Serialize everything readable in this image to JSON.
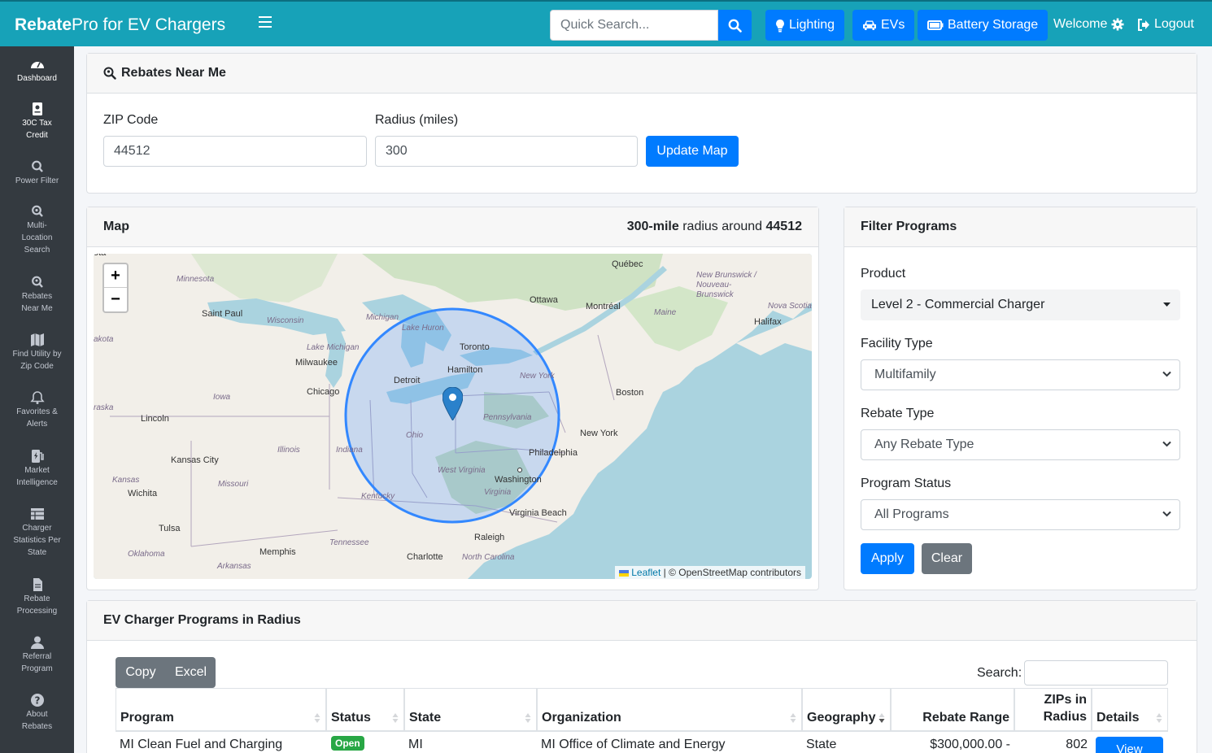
{
  "app": {
    "brand_bold": "Rebate",
    "brand_rest": "Pro for EV Chargers"
  },
  "topnav": {
    "search_placeholder": "Quick Search...",
    "buttons": [
      "Lighting",
      "EVs",
      "Battery Storage"
    ],
    "welcome": "Welcome",
    "logout": "Logout"
  },
  "sidebar": {
    "items": [
      {
        "label": "Dashboard",
        "icon": "gauge-icon"
      },
      {
        "label": "30C Tax Credit",
        "icon": "document-icon"
      },
      {
        "label": "Power Filter",
        "icon": "search-icon"
      },
      {
        "label": "Multi-Location Search",
        "icon": "search-plus-icon"
      },
      {
        "label": "Rebates Near Me",
        "icon": "search-location-icon"
      },
      {
        "label": "Find Utility by Zip Code",
        "icon": "map-icon"
      },
      {
        "label": "Favorites & Alerts",
        "icon": "bell-icon"
      },
      {
        "label": "Market Intelligence",
        "icon": "charging-station-icon"
      },
      {
        "label": "Charger Statistics Per State",
        "icon": "table-icon"
      },
      {
        "label": "Rebate Processing",
        "icon": "file-icon"
      },
      {
        "label": "Referral Program",
        "icon": "user-icon"
      },
      {
        "label": "About Rebates",
        "icon": "question-icon"
      }
    ]
  },
  "rebates_near_me": {
    "title": "Rebates Near Me",
    "zip_label": "ZIP Code",
    "zip_value": "44512",
    "radius_label": "Radius (miles)",
    "radius_value": "300",
    "update_button": "Update Map"
  },
  "map_card": {
    "title": "Map",
    "summary_bold1": "300-mile",
    "summary_mid": " radius around ",
    "summary_bold2": "44512",
    "attribution_link": "Leaflet",
    "attribution_rest": " | © OpenStreetMap contributors",
    "zoom_in": "+",
    "zoom_out": "−",
    "labels": {
      "quebec": "Québec",
      "minnesota": "Minnesota",
      "ottawa": "Ottawa",
      "montreal": "Montréal",
      "new_brunswick": "New Brunswick / Nouveau-Brunswick",
      "saint_paul": "Saint Paul",
      "michigan": "Michigan",
      "wisconsin": "Wisconsin",
      "lake_huron": "Lake Huron",
      "maine": "Maine",
      "nova_scotia": "Nova Scotia",
      "halifax": "Halifax",
      "dakota": "akota",
      "lake_michigan": "Lake Michigan",
      "toronto": "Toronto",
      "milwaukee": "Milwaukee",
      "hamilton": "Hamilton",
      "detroit": "Detroit",
      "new_york_state": "New York",
      "chicago": "Chicago",
      "boston": "Boston",
      "iowa": "Iowa",
      "nebraska": "raska",
      "pennsylvania": "Pennsylvania",
      "lincoln": "Lincoln",
      "ohio": "Ohio",
      "new_york": "New York",
      "illinois": "Illinois",
      "indiana": "Indiana",
      "philadelphia": "Philadelphia",
      "kansas_city": "Kansas City",
      "west_virginia": "West Virginia",
      "kansas": "Kansas",
      "missouri": "Missouri",
      "washington": "Washington",
      "wichita": "Wichita",
      "virginia": "Virginia",
      "kentucky": "Kentucky",
      "virginia_beach": "Virginia Beach",
      "tulsa": "Tulsa",
      "raleigh": "Raleigh",
      "tennessee": "Tennessee",
      "oklahoma": "Oklahoma",
      "memphis": "Memphis",
      "charlotte": "Charlotte",
      "north_carolina": "North Carolina",
      "arkansas": "Arkansas",
      "ota": "ota"
    }
  },
  "filter_programs": {
    "title": "Filter Programs",
    "product_label": "Product",
    "product_value": "Level 2 - Commercial Charger",
    "facility_label": "Facility Type",
    "facility_value": "Multifamily",
    "rebate_type_label": "Rebate Type",
    "rebate_type_value": "Any Rebate Type",
    "status_label": "Program Status",
    "status_value": "All Programs",
    "apply": "Apply",
    "clear": "Clear"
  },
  "programs_table": {
    "title": "EV Charger Programs in Radius",
    "copy": "Copy",
    "excel": "Excel",
    "search_label": "Search:",
    "columns": [
      "Program",
      "Status",
      "State",
      "Organization",
      "Geography",
      "Rebate Range",
      "ZIPs in Radius",
      "Details"
    ],
    "rows": [
      {
        "program": "MI Clean Fuel and Charging",
        "status": "Open",
        "state": "MI",
        "organization": "MI Office of Climate and Energy",
        "geography": "State",
        "rebate_range": "$300,000.00 -",
        "zips": "802",
        "details": "View"
      }
    ]
  },
  "colors": {
    "topbar": "#17a2b8",
    "primary": "#007bff",
    "sidebar": "#343a40",
    "secondary": "#6c757d",
    "open_badge": "#28a745"
  }
}
